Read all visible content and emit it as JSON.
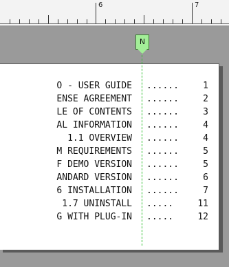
{
  "ruler": {
    "labels": [
      "6",
      "7"
    ]
  },
  "tab_marker": {
    "label": "N"
  },
  "toc": [
    {
      "title": "O - USER GUIDE",
      "leader": "......",
      "page": "1"
    },
    {
      "title": "ENSE AGREEMENT",
      "leader": "......",
      "page": "2"
    },
    {
      "title": "LE OF CONTENTS",
      "leader": "......",
      "page": "3"
    },
    {
      "title": "AL INFORMATION",
      "leader": "......",
      "page": "4"
    },
    {
      "title": "1.1 OVERVIEW",
      "leader": "......",
      "page": "4"
    },
    {
      "title": "M REQUIREMENTS",
      "leader": "......",
      "page": "5"
    },
    {
      "title": "F DEMO VERSION",
      "leader": "......",
      "page": "5"
    },
    {
      "title": "ANDARD VERSION",
      "leader": "......",
      "page": "6"
    },
    {
      "title": "6 INSTALLATION",
      "leader": "......",
      "page": "7"
    },
    {
      "title": "1.7 UNINSTALL",
      "leader": ".....",
      "page": "11"
    },
    {
      "title": "G WITH PLUG-IN",
      "leader": ".....",
      "page": "12"
    }
  ]
}
